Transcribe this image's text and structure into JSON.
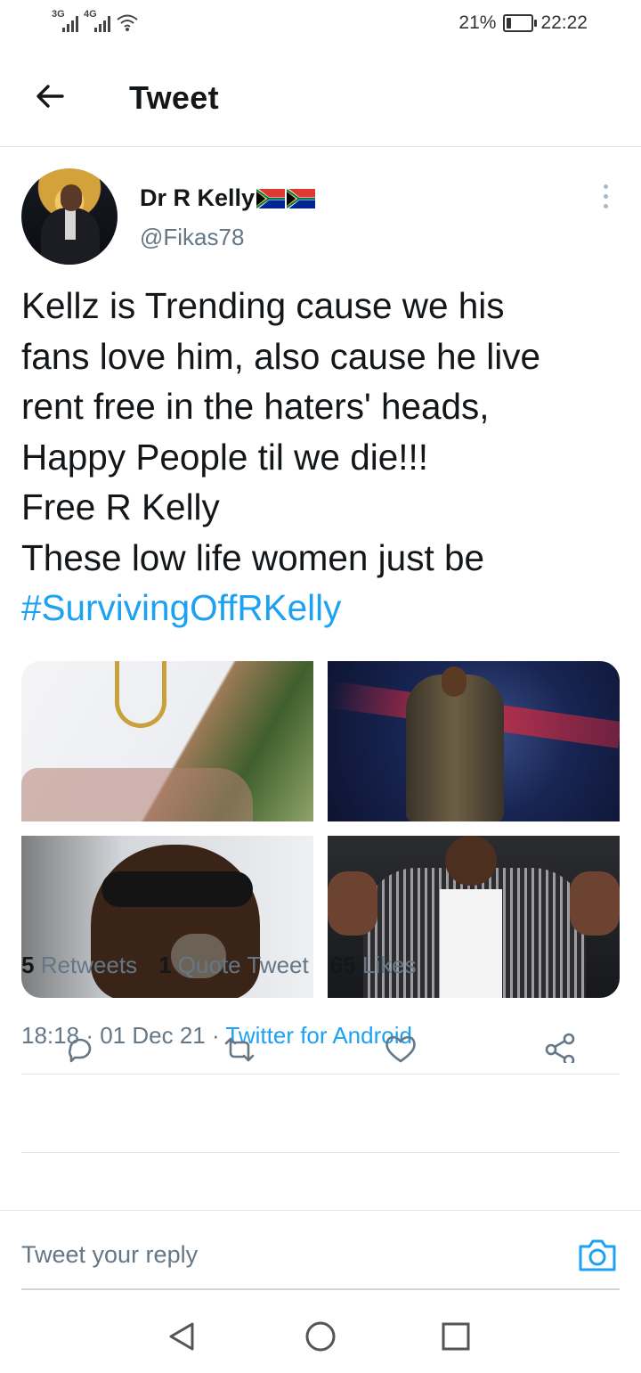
{
  "status_bar": {
    "network_1": "3G",
    "network_2": "4G",
    "battery_text": "21%",
    "battery_level": 0.21,
    "time": "22:22"
  },
  "header": {
    "title": "Tweet",
    "back_icon": "arrow-left-icon"
  },
  "tweet": {
    "author_name": "Dr R Kelly",
    "author_flags": [
      "south-africa-flag",
      "south-africa-flag"
    ],
    "author_handle": "@Fikas78",
    "more_icon": "more-vertical-icon",
    "text_lines": [
      "Kellz is Trending cause we his",
      "fans love him, also cause he live",
      "rent free in the haters' heads,",
      "Happy People til we die!!!",
      "Free R Kelly",
      "These low life women just be"
    ],
    "hashtag": "#SurvivingOffRKelly",
    "photos_count": 4,
    "time": "18:18",
    "date": "01 Dec 21",
    "separator": "·",
    "source": "Twitter for Android"
  },
  "stats": {
    "retweets_count": "5",
    "retweets_label": "Retweets",
    "quotes_count": "1",
    "quotes_label": "Quote Tweet",
    "likes_count": "65",
    "likes_label": "Likes"
  },
  "actions": [
    "reply-icon",
    "retweet-icon",
    "like-icon",
    "share-icon"
  ],
  "reply_bar": {
    "placeholder": "Tweet your reply",
    "camera_icon": "camera-icon"
  },
  "nav_bar": [
    "back-triangle-icon",
    "home-circle-icon",
    "recents-square-icon"
  ],
  "colors": {
    "accent": "#1da1f2",
    "text": "#14171a",
    "secondary_text": "#657786",
    "divider": "#e1e8ed"
  }
}
